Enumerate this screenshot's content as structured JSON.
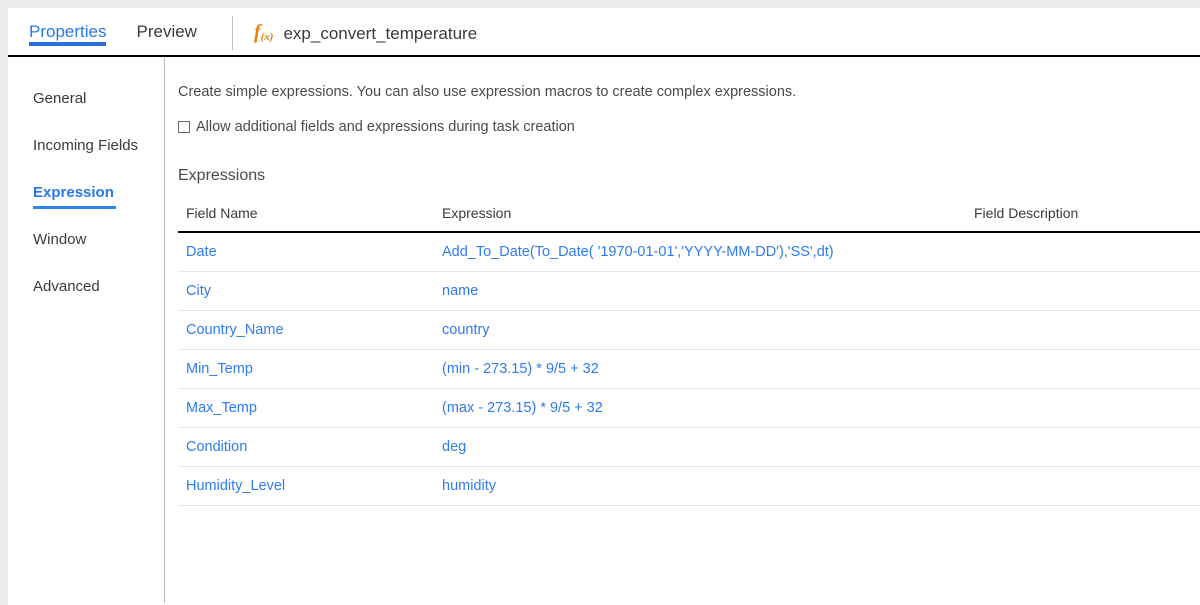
{
  "window": {
    "tabs": [
      {
        "label": "Properties",
        "active": true
      },
      {
        "label": "Preview",
        "active": false
      }
    ],
    "transformation": {
      "icon": "function-fx-icon",
      "icon_main": "f",
      "icon_sub": "(x)",
      "name": "exp_convert_temperature"
    }
  },
  "sidebar": {
    "items": [
      {
        "label": "General",
        "active": false
      },
      {
        "label": "Incoming Fields",
        "active": false
      },
      {
        "label": "Expression",
        "active": true
      },
      {
        "label": "Window",
        "active": false
      },
      {
        "label": "Advanced",
        "active": false
      }
    ]
  },
  "main": {
    "description": "Create simple expressions. You can also use expression macros to create complex expressions.",
    "allow_additional": {
      "label": "Allow additional fields and expressions during task creation",
      "checked": false
    },
    "section_title": "Expressions",
    "table": {
      "columns": [
        "Field Name",
        "Expression",
        "Field Description"
      ],
      "rows": [
        {
          "field_name": "Date",
          "expression": "Add_To_Date(To_Date( '1970-01-01','YYYY-MM-DD'),'SS',dt)",
          "field_description": ""
        },
        {
          "field_name": "City",
          "expression": "name",
          "field_description": ""
        },
        {
          "field_name": "Country_Name",
          "expression": "country",
          "field_description": ""
        },
        {
          "field_name": "Min_Temp",
          "expression": "(min - 273.15) * 9/5 + 32",
          "field_description": ""
        },
        {
          "field_name": "Max_Temp",
          "expression": "(max - 273.15) * 9/5 + 32",
          "field_description": ""
        },
        {
          "field_name": "Condition",
          "expression": "deg",
          "field_description": ""
        },
        {
          "field_name": "Humidity_Level",
          "expression": "humidity",
          "field_description": ""
        }
      ]
    }
  },
  "colors": {
    "accent_blue": "#2979e8",
    "link_blue": "#2f7bf0",
    "tab_underline": "#2a6fd4",
    "fx_orange": "#e8820c",
    "text_dark": "#3a3a3a",
    "page_background": "#ebebeb"
  }
}
